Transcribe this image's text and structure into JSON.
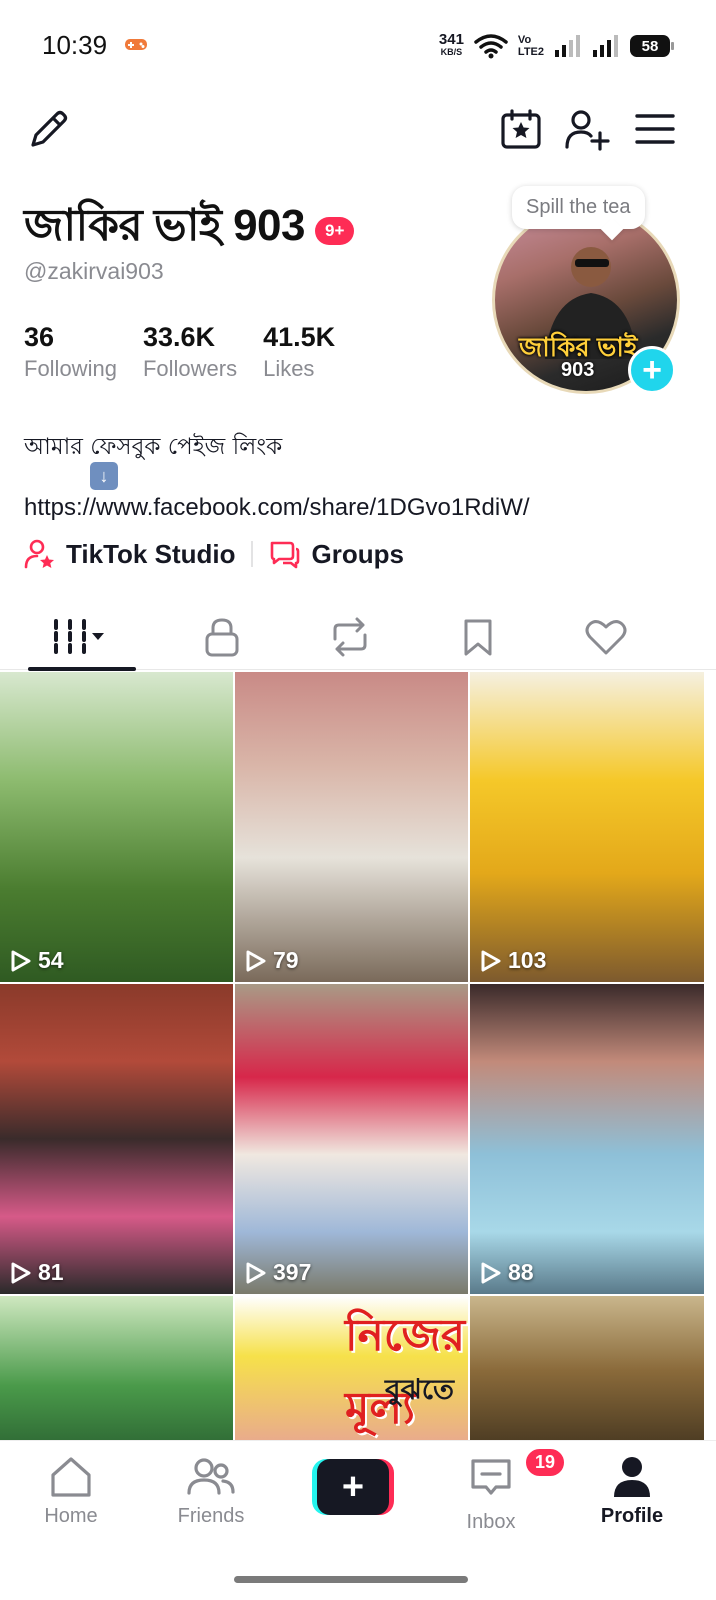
{
  "status_bar": {
    "time": "10:39",
    "net_speed_value": "341",
    "net_speed_unit": "KB/S",
    "volte_top": "Vo",
    "volte_bottom": "LTE2",
    "battery": "58"
  },
  "profile": {
    "display_name": "জাকির ভাই 903",
    "notification_badge": "9+",
    "handle": "@zakirvai903",
    "stats": [
      {
        "value": "36",
        "label": "Following"
      },
      {
        "value": "33.6K",
        "label": "Followers"
      },
      {
        "value": "41.5K",
        "label": "Likes"
      }
    ],
    "avatar_bubble": "Spill the tea",
    "avatar_text_line1": "জাকির ভাই",
    "avatar_text_line2": "903",
    "bio_line1": "আমার ফেসবুক পেইজ লিংক",
    "bio_link": "https://www.facebook.com/share/1DGvo1RdiW/",
    "quick_links": [
      {
        "label": "TikTok Studio",
        "icon": "user-star-icon"
      },
      {
        "label": "Groups",
        "icon": "chat-bubbles-icon"
      }
    ]
  },
  "tabs": [
    {
      "icon": "grid-videos-icon",
      "active": true
    },
    {
      "icon": "lock-icon",
      "active": false
    },
    {
      "icon": "repost-icon",
      "active": false
    },
    {
      "icon": "bookmark-icon",
      "active": false
    },
    {
      "icon": "heart-icon",
      "active": false
    }
  ],
  "videos": [
    {
      "views": "54"
    },
    {
      "views": "79"
    },
    {
      "views": "103"
    },
    {
      "views": "81"
    },
    {
      "views": "397"
    },
    {
      "views": "88"
    }
  ],
  "thumbnail_overlay": {
    "line1": "নিজের মূল্য",
    "line2": "বুঝতে"
  },
  "bottom_nav": {
    "home": "Home",
    "friends": "Friends",
    "inbox": "Inbox",
    "inbox_badge": "19",
    "profile": "Profile"
  },
  "colors": {
    "accent_red": "#fe2c55",
    "accent_cyan": "#25f4ee",
    "avatar_add": "#20d5ec",
    "text_primary": "#161823",
    "text_secondary": "#8a8b91"
  }
}
